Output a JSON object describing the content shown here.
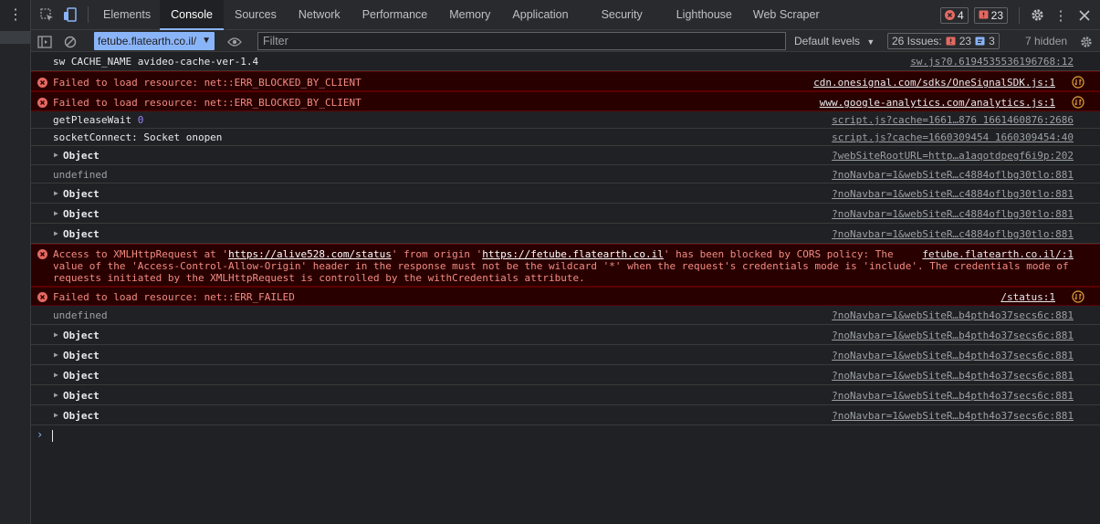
{
  "tabs": [
    "Elements",
    "Console",
    "Sources",
    "Network",
    "Performance",
    "Memory",
    "Application",
    "Security",
    "Lighthouse",
    "Web Scraper"
  ],
  "active_tab": "Console",
  "badges": {
    "errors": "4",
    "issues": "23"
  },
  "toolbar": {
    "context": "fetube.flatearth.co.il/",
    "filter_placeholder": "Filter",
    "levels": "Default levels",
    "issues_label": "26 Issues:",
    "issues_errors": "23",
    "issues_info": "3",
    "hidden": "7 hidden"
  },
  "log": [
    {
      "type": "log",
      "message": "sw CACHE_NAME avideo-cache-ver-1.4",
      "source": "sw.js?0.6194535536196768:12"
    },
    {
      "type": "error",
      "message": "Failed to load resource: net::ERR_BLOCKED_BY_CLIENT",
      "source": "cdn.onesignal.com/sdks/OneSignalSDK.js:1"
    },
    {
      "type": "error",
      "message": "Failed to load resource: net::ERR_BLOCKED_BY_CLIENT",
      "source": "www.google-analytics.com/analytics.js:1"
    },
    {
      "type": "log",
      "message": "getPleaseWait ",
      "number": "0",
      "source": "script.js?cache=1661…876 1661460876:2686"
    },
    {
      "type": "log",
      "message": "socketConnect: Socket onopen",
      "source": "script.js?cache=1660309454 1660309454:40"
    },
    {
      "type": "object",
      "message": "Object",
      "source": "?webSiteRootURL=http…a1aqotdpegf6i9p:202"
    },
    {
      "type": "undefined",
      "message": "undefined",
      "source": "?noNavbar=1&webSiteR…c4884oflbg30tlo:881"
    },
    {
      "type": "object",
      "message": "Object",
      "source": "?noNavbar=1&webSiteR…c4884oflbg30tlo:881"
    },
    {
      "type": "object",
      "message": "Object",
      "source": "?noNavbar=1&webSiteR…c4884oflbg30tlo:881"
    },
    {
      "type": "object",
      "message": "Object",
      "source": "?noNavbar=1&webSiteR…c4884oflbg30tlo:881"
    }
  ],
  "cors_error": {
    "prefix": "Access to XMLHttpRequest at '",
    "url1": "https://alive528.com/status",
    "middle": "' from origin '",
    "url2": "https://fetube.flatearth.co.il",
    "suffix": "' has been blocked by CORS policy: The",
    "line2": "value of the 'Access-Control-Allow-Origin' header in the response must not be the wildcard '*' when the request's credentials mode is 'include'. The credentials mode of",
    "line3": "requests initiated by the XMLHttpRequest is controlled by the withCredentials attribute.",
    "source": "fetube.flatearth.co.il/:1"
  },
  "log2": [
    {
      "type": "error",
      "message": "Failed to load resource: net::ERR_FAILED",
      "source": "/status:1"
    },
    {
      "type": "undefined",
      "message": "undefined",
      "source": "?noNavbar=1&webSiteR…b4pth4o37secs6c:881"
    },
    {
      "type": "object",
      "message": "Object",
      "source": "?noNavbar=1&webSiteR…b4pth4o37secs6c:881"
    },
    {
      "type": "object",
      "message": "Object",
      "source": "?noNavbar=1&webSiteR…b4pth4o37secs6c:881"
    },
    {
      "type": "object",
      "message": "Object",
      "source": "?noNavbar=1&webSiteR…b4pth4o37secs6c:881"
    },
    {
      "type": "object",
      "message": "Object",
      "source": "?noNavbar=1&webSiteR…b4pth4o37secs6c:881"
    },
    {
      "type": "object",
      "message": "Object",
      "source": "?noNavbar=1&webSiteR…b4pth4o37secs6c:881"
    }
  ],
  "colors": {
    "accent": "#8ab4f8",
    "error_text": "#f28b82",
    "error_bg": "#290000",
    "panel": "#202124"
  }
}
